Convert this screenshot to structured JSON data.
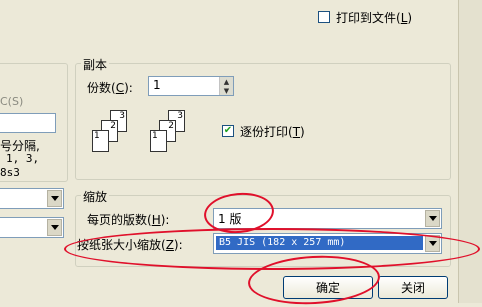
{
  "print_to_file": {
    "label": "打印到文件(",
    "key": "L",
    "tail": ")",
    "checked": false
  },
  "left_fragments": {
    "hint_s": "C(S)",
    "line1": "号分隔,",
    "line2": "1, 3,",
    "line3": "8s3"
  },
  "copies": {
    "group_title": "副本",
    "count_label": "份数(",
    "count_key": "C",
    "count_tail": "):",
    "count_value": "1",
    "collate_label": "逐份打印(",
    "collate_key": "T",
    "collate_tail": ")",
    "collate_checked": true,
    "stack1_pages": [
      "3",
      "2",
      "1"
    ],
    "stack2_pages": [
      "3",
      "2",
      "1"
    ]
  },
  "zoom": {
    "group_title": "缩放",
    "pages_per_sheet_label": "每页的版数(",
    "pages_per_sheet_key": "H",
    "pages_per_sheet_tail": "):",
    "pages_per_sheet_value": "1 版",
    "scale_label": "按纸张大小缩放(",
    "scale_key": "Z",
    "scale_tail": "):",
    "scale_value": "B5 JIS (182 x 257 mm)"
  },
  "buttons": {
    "ok": "确定",
    "close": "关闭"
  }
}
